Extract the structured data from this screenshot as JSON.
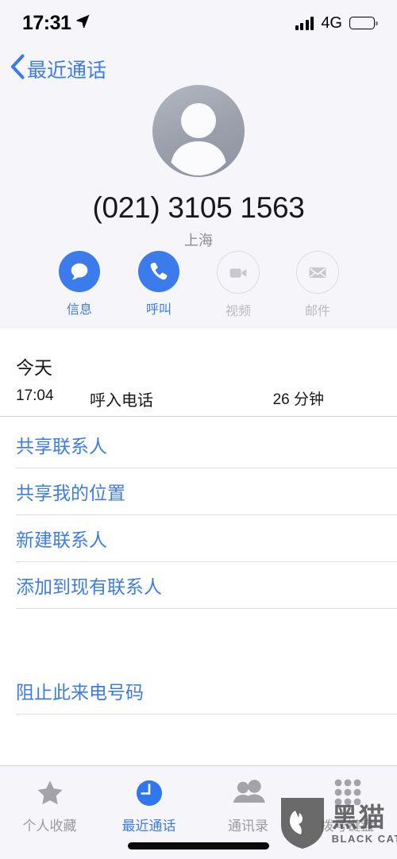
{
  "status_bar": {
    "time": "17:31",
    "location_icon": "location-arrow-icon",
    "signal_icon": "cellular-signal-icon",
    "network": "4G",
    "battery_icon": "battery-full-icon"
  },
  "nav": {
    "back_icon": "chevron-left-icon",
    "back_label": "最近通话"
  },
  "contact": {
    "avatar_icon": "person-placeholder-avatar",
    "phone_number": "(021) 3105 1563",
    "locality": "上海",
    "actions": [
      {
        "label": "信息",
        "icon": "message-bubble-icon",
        "enabled": true
      },
      {
        "label": "呼叫",
        "icon": "phone-handset-icon",
        "enabled": true
      },
      {
        "label": "视频",
        "icon": "video-camera-icon",
        "enabled": false
      },
      {
        "label": "邮件",
        "icon": "envelope-icon",
        "enabled": false
      }
    ]
  },
  "call_history": {
    "day": "今天",
    "entry": {
      "time": "17:04",
      "type": "呼入电话",
      "duration": "26 分钟"
    }
  },
  "options": [
    {
      "label": "共享联系人"
    },
    {
      "label": "共享我的位置"
    },
    {
      "label": "新建联系人"
    },
    {
      "label": "添加到现有联系人"
    }
  ],
  "block_action": {
    "label": "阻止此来电号码"
  },
  "tab_bar": {
    "tabs": [
      {
        "label": "个人收藏",
        "icon": "star-icon",
        "active": false
      },
      {
        "label": "最近通话",
        "icon": "clock-icon",
        "active": true
      },
      {
        "label": "通讯录",
        "icon": "people-icon",
        "active": false
      },
      {
        "label": "拨号键盘",
        "icon": "keypad-icon",
        "active": false
      }
    ]
  },
  "watermark": {
    "logo_icon": "black-cat-shield-logo",
    "cn": "黑猫",
    "en": "BLACK CAT"
  },
  "colors": {
    "accent_blue": "#3d7ce6",
    "button_blue": "#3b7bec",
    "header_bg": "#f6f6fa",
    "disabled_gray": "#b9b9c0"
  }
}
